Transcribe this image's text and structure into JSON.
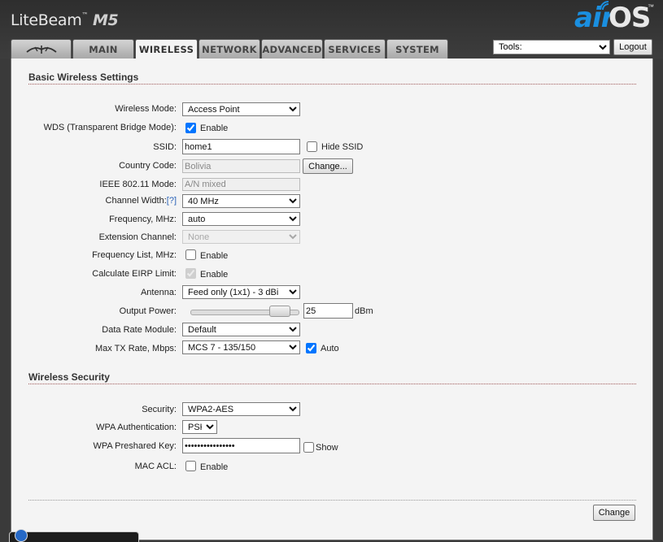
{
  "header": {
    "product_name": "LiteBeam",
    "product_tm": "™",
    "product_model": "M5",
    "brand_air": "air",
    "brand_os": "OS",
    "brand_tm": "™"
  },
  "tabs": [
    {
      "label": "",
      "icon": "ubiquiti-logo-icon"
    },
    {
      "label": "MAIN"
    },
    {
      "label": "WIRELESS",
      "active": true
    },
    {
      "label": "NETWORK"
    },
    {
      "label": "ADVANCED"
    },
    {
      "label": "SERVICES"
    },
    {
      "label": "SYSTEM"
    }
  ],
  "tools": {
    "selected": "Tools:"
  },
  "logout_label": "Logout",
  "basic": {
    "title": "Basic Wireless Settings",
    "wireless_mode_label": "Wireless Mode:",
    "wireless_mode_value": "Access Point",
    "wds_label": "WDS (Transparent Bridge Mode):",
    "wds_checked": true,
    "enable_text": "Enable",
    "ssid_label": "SSID:",
    "ssid_value": "home1",
    "hide_ssid_label": "Hide SSID",
    "hide_ssid_checked": false,
    "country_label": "Country Code:",
    "country_value": "Bolivia",
    "change_ellipsis_label": "Change...",
    "ieee_label": "IEEE 802.11 Mode:",
    "ieee_value": "A/N mixed",
    "channel_width_label": "Channel Width:",
    "channel_width_help": "[?]",
    "channel_width_value": "40 MHz",
    "frequency_label": "Frequency, MHz:",
    "frequency_value": "auto",
    "ext_channel_label": "Extension Channel:",
    "ext_channel_value": "None",
    "freq_list_label": "Frequency List, MHz:",
    "freq_list_checked": false,
    "eirp_label": "Calculate EIRP Limit:",
    "eirp_checked": true,
    "antenna_label": "Antenna:",
    "antenna_value": "Feed only (1x1) - 3 dBi",
    "output_power_label": "Output Power:",
    "output_power_value": "25",
    "output_power_level": 0.9,
    "output_power_unit": "dBm",
    "data_rate_label": "Data Rate Module:",
    "data_rate_value": "Default",
    "max_tx_label": "Max TX Rate, Mbps:",
    "max_tx_value": "MCS 7 - 135/150",
    "auto_label": "Auto",
    "auto_checked": true
  },
  "security": {
    "title": "Wireless Security",
    "security_label": "Security:",
    "security_value": "WPA2-AES",
    "wpa_auth_label": "WPA Authentication:",
    "wpa_auth_value": "PSK",
    "wpa_key_label": "WPA Preshared Key:",
    "wpa_key_value": "••••••••••••••••",
    "show_label": "Show",
    "show_checked": false,
    "mac_acl_label": "MAC ACL:",
    "mac_acl_checked": false
  },
  "change_label": "Change"
}
